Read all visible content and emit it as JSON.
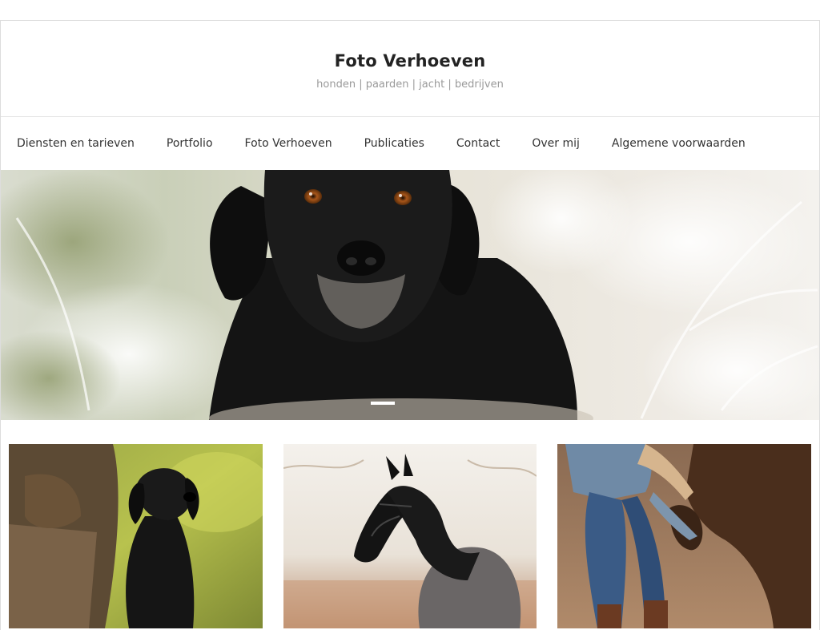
{
  "site": {
    "title": "Foto Verhoeven",
    "tagline": "honden | paarden | jacht | bedrijven"
  },
  "nav": {
    "items": [
      {
        "label": "Diensten en tarieven"
      },
      {
        "label": "Portfolio"
      },
      {
        "label": "Foto Verhoeven"
      },
      {
        "label": "Publicaties"
      },
      {
        "label": "Contact"
      },
      {
        "label": "Over mij"
      },
      {
        "label": "Algemene voorwaarden"
      }
    ]
  },
  "hero": {
    "slides_total": 1,
    "active_slide": 1
  },
  "colors": {
    "title": "#222222",
    "tagline": "#9a9a9a",
    "nav_text": "#333333",
    "border": "#dddddd"
  }
}
